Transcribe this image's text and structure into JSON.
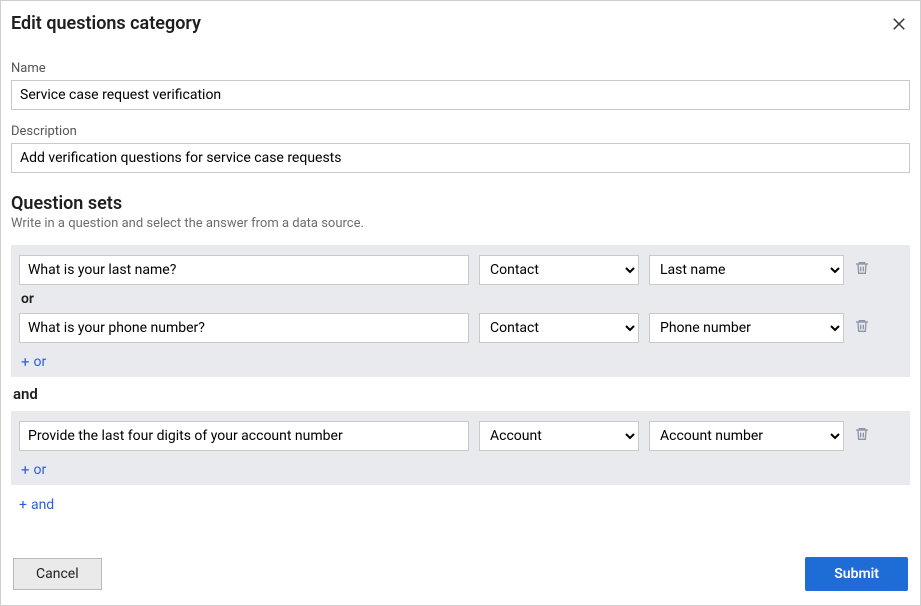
{
  "dialog": {
    "title": "Edit questions category",
    "name_label": "Name",
    "name_value": "Service case request verification",
    "description_label": "Description",
    "description_value": "Add verification questions for service case requests"
  },
  "section": {
    "title": "Question sets",
    "subtitle": "Write in a question and select the answer from a data source."
  },
  "groups": [
    {
      "rows": [
        {
          "question": "What is your last name?",
          "source": "Contact",
          "answer": "Last name"
        },
        {
          "question": "What is your phone number?",
          "source": "Contact",
          "answer": "Phone number"
        }
      ],
      "or_label": "or",
      "add_or_label": "or"
    },
    {
      "rows": [
        {
          "question": "Provide the last four digits of your account number",
          "source": "Account",
          "answer": "Account number"
        }
      ],
      "add_or_label": "or"
    }
  ],
  "and_separator": "and",
  "add_and_label": "and",
  "footer": {
    "cancel": "Cancel",
    "submit": "Submit"
  }
}
